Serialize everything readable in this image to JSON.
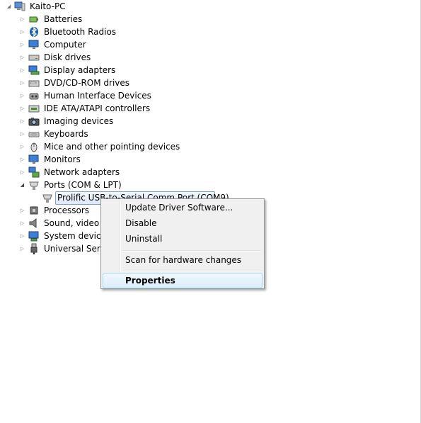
{
  "tree": {
    "root": {
      "label": "Kaito-PC",
      "icon": "computer-icon"
    },
    "categories": [
      {
        "label": "Batteries",
        "icon": "battery-icon"
      },
      {
        "label": "Bluetooth Radios",
        "icon": "bluetooth-icon"
      },
      {
        "label": "Computer",
        "icon": "monitor-icon"
      },
      {
        "label": "Disk drives",
        "icon": "disk-drive-icon"
      },
      {
        "label": "Display adapters",
        "icon": "display-adapter-icon"
      },
      {
        "label": "DVD/CD-ROM drives",
        "icon": "dvd-drive-icon"
      },
      {
        "label": "Human Interface Devices",
        "icon": "hid-icon"
      },
      {
        "label": "IDE ATA/ATAPI controllers",
        "icon": "ide-controller-icon"
      },
      {
        "label": "Imaging devices",
        "icon": "camera-icon"
      },
      {
        "label": "Keyboards",
        "icon": "keyboard-icon"
      },
      {
        "label": "Mice and other pointing devices",
        "icon": "mouse-icon"
      },
      {
        "label": "Monitors",
        "icon": "monitor-icon"
      },
      {
        "label": "Network adapters",
        "icon": "network-icon"
      },
      {
        "label": "Ports (COM & LPT)",
        "icon": "port-icon"
      },
      {
        "label": "Processors",
        "icon": "processor-icon"
      },
      {
        "label": "Sound, video an",
        "icon": "speaker-icon"
      },
      {
        "label": "System devices",
        "icon": "system-icon"
      },
      {
        "label": "Universal Serial",
        "icon": "usb-icon"
      }
    ],
    "selected_child": {
      "label": "Prolific USB-to-Serial Comm Port (COM9)",
      "icon": "port-icon"
    }
  },
  "context_menu": {
    "update_driver": "Update Driver Software...",
    "disable": "Disable",
    "uninstall": "Uninstall",
    "scan": "Scan for hardware changes",
    "properties": "Properties"
  }
}
